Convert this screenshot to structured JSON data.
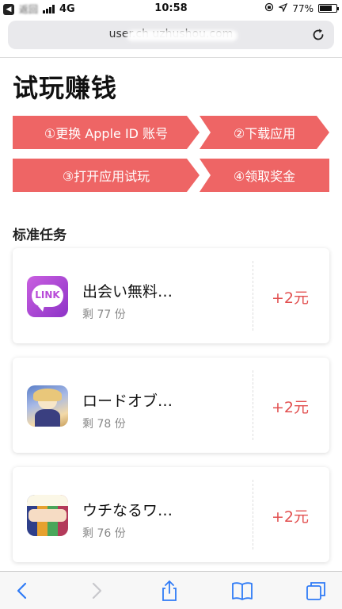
{
  "status_bar": {
    "back_app": "返回",
    "network": "4G",
    "time": "10:58",
    "battery": "77%",
    "battery_level": 0.77
  },
  "browser": {
    "url": "user.ch        uzhushou.com"
  },
  "page": {
    "title": "试玩赚钱",
    "steps": [
      "①更换 Apple ID 账号",
      "②下载应用",
      "③打开应用试玩",
      "④领取奖金"
    ],
    "section_title": "标准任务",
    "tasks": [
      {
        "name": "出会い無料…",
        "remaining": "剩 77 份",
        "reward": "+2元",
        "icon_text": "LINK"
      },
      {
        "name": "ロードオブ…",
        "remaining": "剩 78 份",
        "reward": "+2元"
      },
      {
        "name": "ウチなるワ…",
        "remaining": "剩 76 份",
        "reward": "+2元"
      }
    ]
  },
  "colors": {
    "accent": "#ee6565",
    "reward": "#e25050",
    "ios_blue": "#2f7bf6"
  }
}
